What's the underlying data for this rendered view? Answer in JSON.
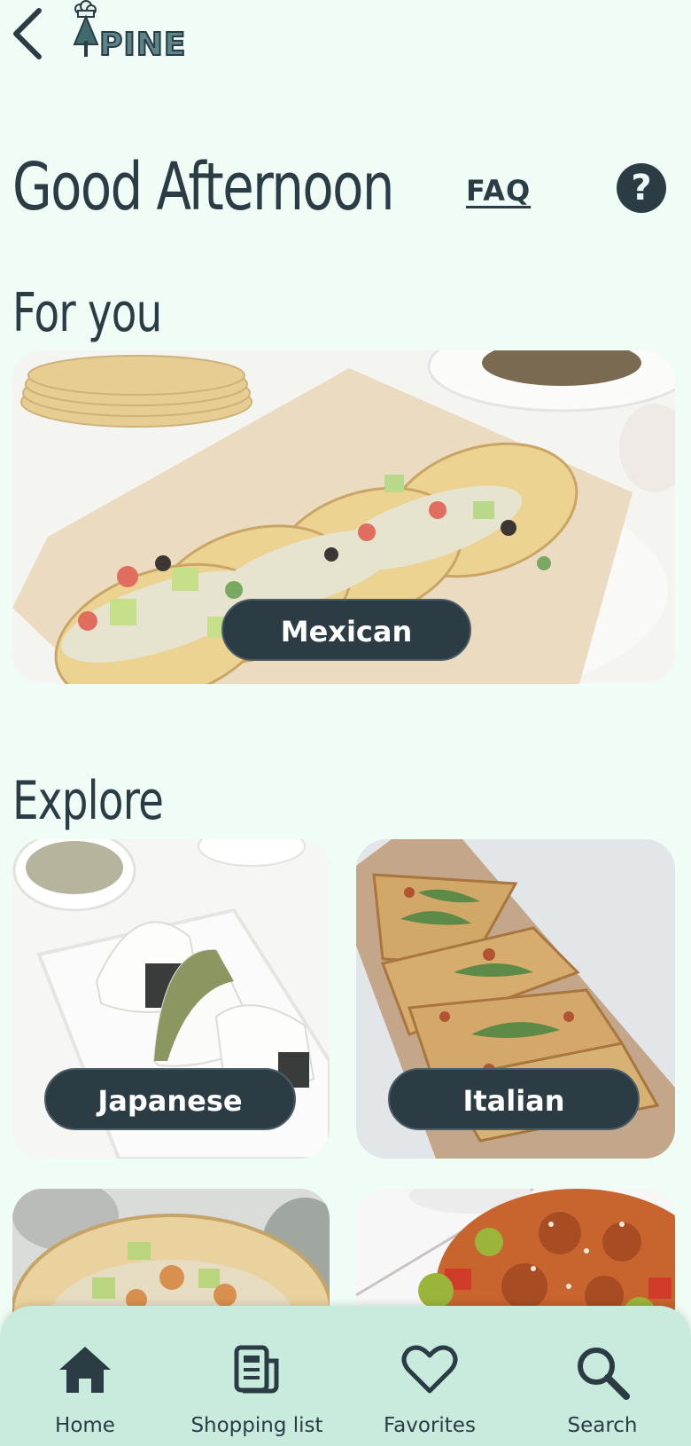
{
  "header": {
    "back_icon": "chevron-left-icon",
    "logo_text": "PINE"
  },
  "greeting": "Good Afternoon",
  "faq_label": "FAQ",
  "help_icon_glyph": "?",
  "for_you": {
    "title": "For you",
    "card": {
      "label": "Mexican",
      "image": "tacos-photo"
    }
  },
  "explore": {
    "title": "Explore",
    "cards": [
      {
        "label": "Japanese",
        "image": "onigiri-photo"
      },
      {
        "label": "Italian",
        "image": "flatbread-pizza-photo"
      },
      {
        "label": "",
        "image": "taco-bowl-photo"
      },
      {
        "label": "",
        "image": "sesame-chicken-photo"
      }
    ]
  },
  "bottom_nav": {
    "items": [
      {
        "label": "Home",
        "icon": "home-icon"
      },
      {
        "label": "Shopping list",
        "icon": "list-icon"
      },
      {
        "label": "Favorites",
        "icon": "heart-icon"
      },
      {
        "label": "Search",
        "icon": "search-icon"
      }
    ]
  },
  "colors": {
    "background": "#effdf6",
    "primary_dark": "#2b3c44",
    "nav_background": "#c8ebdd"
  }
}
